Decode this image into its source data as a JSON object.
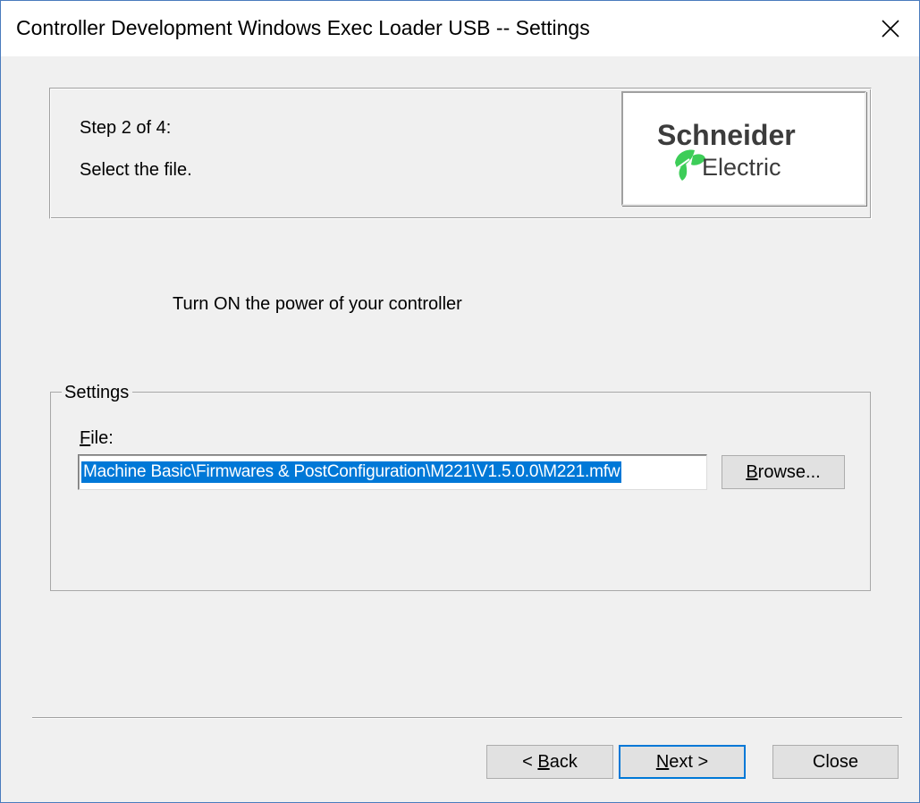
{
  "window": {
    "title": "Controller Development Windows Exec Loader USB -- Settings",
    "close_icon": "close-icon"
  },
  "header": {
    "step": "Step 2 of 4:",
    "description": "Select the file.",
    "logo": {
      "brand_line1": "Schneider",
      "brand_line2": "Electric",
      "brand_color": "#3dcd58",
      "text_color": "#3c3c3c"
    }
  },
  "instruction": "Turn ON the power of your controller",
  "settings": {
    "group_label": "Settings",
    "file_label_accel": "F",
    "file_label_rest": "ile:",
    "file_value": "Machine Basic\\Firmwares & PostConfiguration\\M221\\V1.5.0.0\\M221.mfw",
    "browse_accel": "B",
    "browse_rest": "rowse..."
  },
  "footer": {
    "back_prefix": "< ",
    "back_accel": "B",
    "back_rest": "ack",
    "next_accel": "N",
    "next_rest": "ext >",
    "close_label": "Close"
  },
  "colors": {
    "selection": "#0078d7",
    "default_button_border": "#0078d7",
    "window_border": "#4a7bbd"
  }
}
